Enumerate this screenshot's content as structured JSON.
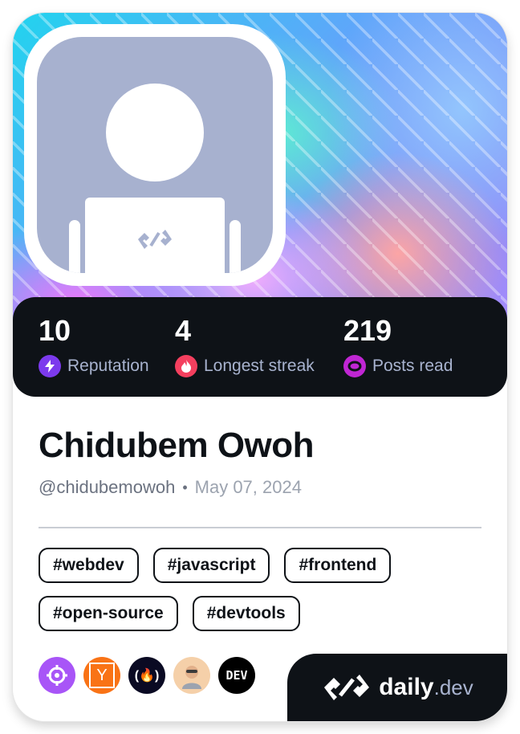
{
  "profile": {
    "name": "Chidubem Owoh",
    "handle": "@chidubemowoh",
    "joined": "May 07, 2024"
  },
  "stats": [
    {
      "value": "10",
      "label": "Reputation",
      "icon": "bolt-icon",
      "color": "#7c3aed"
    },
    {
      "value": "4",
      "label": "Longest streak",
      "icon": "flame-icon",
      "color": "#f43f5e"
    },
    {
      "value": "219",
      "label": "Posts read",
      "icon": "eye-icon",
      "color": "#c026d3"
    }
  ],
  "tags": [
    "#webdev",
    "#javascript",
    "#frontend",
    "#open-source",
    "#devtools"
  ],
  "sources": [
    {
      "icon": "target-icon",
      "color": "#a855f7"
    },
    {
      "icon": "y-letter-icon",
      "color": "#f97316",
      "text": "Y"
    },
    {
      "icon": "freecodecamp-icon",
      "color": "#0a0a23",
      "text": "(🔥)"
    },
    {
      "icon": "avatar-source-icon",
      "color": "#f5d0a9"
    },
    {
      "icon": "dev-logo-icon",
      "color": "#000000",
      "text": "DEV"
    }
  ],
  "brand": {
    "word": "daily",
    "suffix": ".dev"
  }
}
